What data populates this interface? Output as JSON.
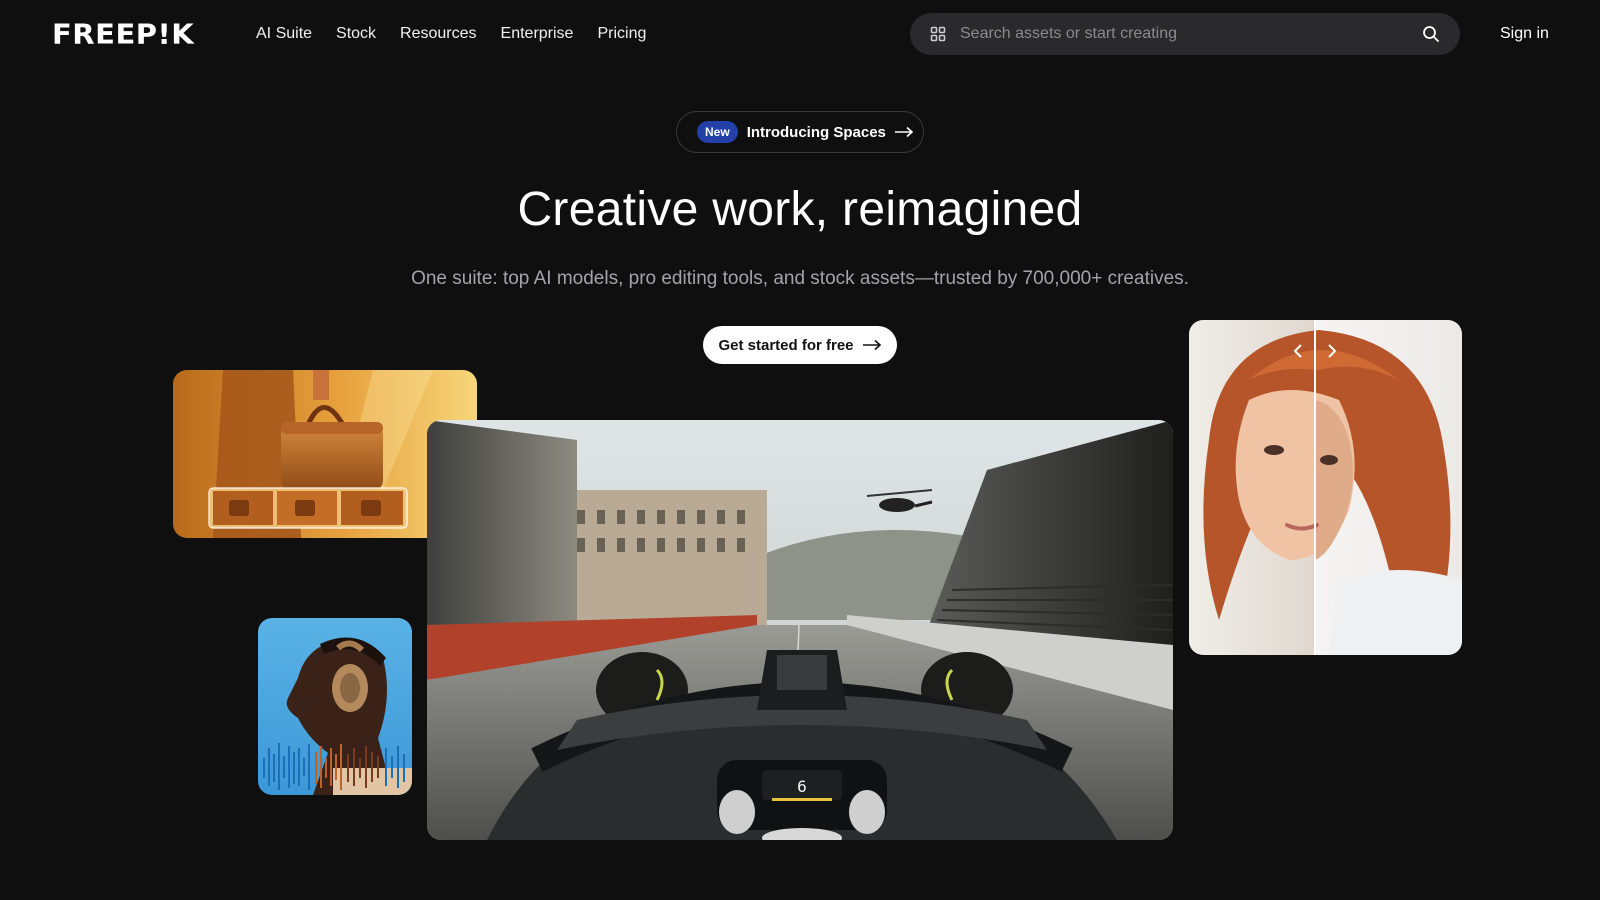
{
  "brand": {
    "logo": "FREEP!K"
  },
  "nav": {
    "items": [
      "AI Suite",
      "Stock",
      "Resources",
      "Enterprise",
      "Pricing"
    ]
  },
  "search": {
    "placeholder": "Search assets or start creating"
  },
  "header": {
    "signin": "Sign in"
  },
  "hero": {
    "badge": "New",
    "announcement": "Introducing Spaces",
    "title": "Creative work, reimagined",
    "subtitle": "One suite: top AI models, pro editing tools, and stock assets—trusted by 700,000+ creatives.",
    "cta": "Get started for free"
  },
  "media": {
    "bag": {
      "icon": "handbag-photo"
    },
    "music": {
      "icon": "headphones-portrait"
    },
    "car": {
      "icon": "race-car-cockpit-video",
      "speed_digit": "6"
    },
    "portrait": {
      "icon": "before-after-portrait"
    }
  },
  "colors": {
    "background": "#0f0f10",
    "accent_badge": "#233fa8",
    "search_bg": "#2a2a2c",
    "muted_text": "#a4a4a8"
  }
}
